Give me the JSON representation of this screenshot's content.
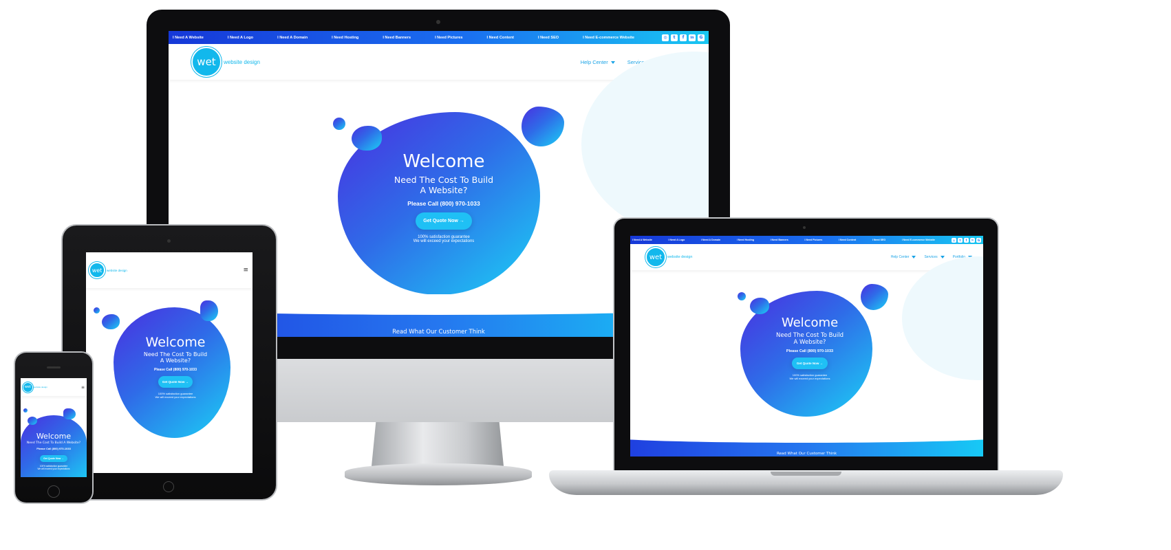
{
  "site": {
    "top_links": [
      "I Need A Website",
      "I Need A Logo",
      "I Need A Domain",
      "I Need Hosting",
      "I Need Banners",
      "I Need Pictures",
      "I Need Content",
      "I Need SEO",
      "I Need E-commerce Website"
    ],
    "socials": [
      "instagram-icon",
      "twitter-icon",
      "facebook-icon",
      "linkedin-icon",
      "google-icon"
    ],
    "social_glyphs": [
      "◎",
      "t",
      "f",
      "in",
      "G"
    ],
    "logo_mark": "wet",
    "logo_text": "website design",
    "nav": [
      "Help Center",
      "Services",
      "Portfolio"
    ],
    "hamburger": "≡",
    "welcome": "Welcome",
    "question_line1": "Need The Cost To Build",
    "question_line2": "A Website?",
    "question_phone": "Need The Cost To Build A Website?",
    "phone": "Please Call (800) 970-1033",
    "cta": "Get Quote Now →",
    "guarantee_line1": "100% satisfaction guarantee",
    "guarantee_line2": "We will exceed your expectations",
    "reviews": "Read What Our Customer Think"
  },
  "colors": {
    "accent": "#12b8ec",
    "gradient_start": "#4a2fe0",
    "gradient_end": "#1bd0f5",
    "topbar": "#1638d8"
  }
}
